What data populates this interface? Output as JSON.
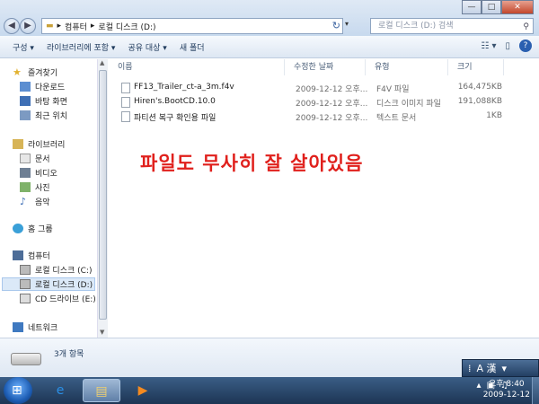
{
  "window": {
    "min": "—",
    "max": "□",
    "close": "✕"
  },
  "address": {
    "crumbs": [
      "컴퓨터",
      "로컬 디스크 (D:)"
    ],
    "separator": "▸"
  },
  "search": {
    "placeholder": "로컬 디스크 (D:) 검색"
  },
  "toolbar": {
    "organize": "구성 ▾",
    "include_library": "라이브러리에 포함 ▾",
    "share": "공유 대상 ▾",
    "new_folder": "새 폴더",
    "help": "?"
  },
  "nav": {
    "favorites": "즐겨찾기",
    "downloads": "다운로드",
    "desktop": "바탕 화면",
    "recent": "최근 위치",
    "libraries": "라이브러리",
    "documents": "문서",
    "videos": "비디오",
    "pictures": "사진",
    "music": "음악",
    "homegroup": "홈 그룹",
    "computer": "컴퓨터",
    "drive_c": "로컬 디스크 (C:)",
    "drive_d": "로컬 디스크 (D:)",
    "drive_e": "CD 드라이브 (E:)",
    "network": "네트워크"
  },
  "columns": {
    "name": "이름",
    "modified": "수정한 날짜",
    "type": "유형",
    "size": "크기"
  },
  "files": [
    {
      "name": "FF13_Trailer_ct-a_3m.f4v",
      "modified": "2009-12-12 오후...",
      "type": "F4V 파일",
      "size": "164,475KB"
    },
    {
      "name": "Hiren's.BootCD.10.0",
      "modified": "2009-12-12 오후...",
      "type": "디스크 이미지 파일",
      "size": "191,088KB"
    },
    {
      "name": "파티션 복구 확인용 파일",
      "modified": "2009-12-12 오후...",
      "type": "텍스트 문서",
      "size": "1KB"
    }
  ],
  "overlay_text": "파일도 무사히 잘 살아있음",
  "details": {
    "item_count": "3개 항목"
  },
  "taskbar": {
    "clock_time": "오후 8:40",
    "clock_date": "2009-12-12",
    "lang": "A 漢"
  }
}
